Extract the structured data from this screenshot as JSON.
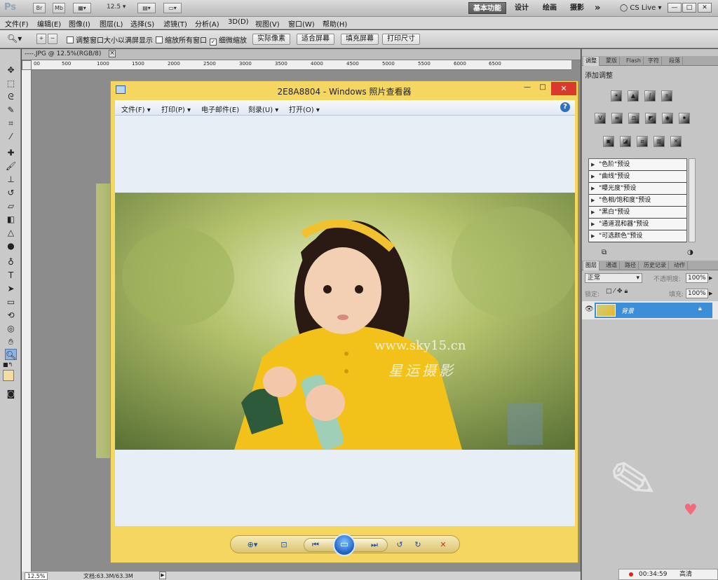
{
  "app": {
    "logo": "Ps",
    "zoom_combo": "12.5",
    "workspaces": [
      "基本功能",
      "设计",
      "绘画",
      "摄影"
    ],
    "more_glyph": "»",
    "cs_live": "CS Live",
    "win_buttons": [
      "—",
      "□",
      "✕"
    ]
  },
  "menubar": {
    "items": [
      "文件(F)",
      "编辑(E)",
      "图像(I)",
      "图层(L)",
      "选择(S)",
      "滤镜(T)",
      "分析(A)",
      "3D(D)",
      "视图(V)",
      "窗口(W)",
      "帮助(H)"
    ]
  },
  "options": {
    "chk_fit": "调整窗口大小以满屏显示",
    "chk_all": "缩放所有窗口",
    "chk_scrubby": "细微缩放",
    "btn_actual": "实际像素",
    "btn_fit": "适合屏幕",
    "btn_fill": "填充屏幕",
    "btn_print": "打印尺寸"
  },
  "doc": {
    "tab_label": "----.JPG @ 12.5%(RGB/8)",
    "tab_close": "×",
    "ruler_labels": [
      "00",
      "500",
      "1000",
      "1500",
      "2000",
      "2500",
      "3000",
      "3500",
      "4000",
      "4500",
      "5000",
      "5500",
      "6000",
      "6500"
    ],
    "status_zoom": "12.5%",
    "status_doc": "文档:63.3M/63.3M"
  },
  "viewer": {
    "title": "2E8A8804 - Windows 照片查看器",
    "menu": [
      "文件(F)",
      "打印(P)",
      "电子邮件(E)",
      "刻录(U)",
      "打开(O)"
    ],
    "help": "?",
    "watermark_url": "www.sky15.cn",
    "watermark_cn": "星运摄影",
    "controls": [
      "—",
      "□",
      "✕"
    ]
  },
  "right": {
    "top_tabs": [
      "调整",
      "蒙版",
      "Flash",
      "字符",
      "段落"
    ],
    "add_adjust": "添加调整",
    "presets": [
      "\"色阶\"预设",
      "\"曲线\"预设",
      "\"曝光度\"预设",
      "\"色相/饱和度\"预设",
      "\"黑白\"预设",
      "\"通道混和器\"预设",
      "\"可选颜色\"预设"
    ],
    "layer_tabs": [
      "图层",
      "通道",
      "路径",
      "历史记录",
      "动作"
    ],
    "blend_mode": "正常",
    "opacity_label": "不透明度:",
    "opacity_value": "100%",
    "lock_label": "锁定:",
    "fill_label": "填充:",
    "fill_value": "100%",
    "layer_name": "背景"
  },
  "recorder": {
    "time": "00:34:59",
    "quality": "高清"
  },
  "colors": {
    "viewer_frame": "#f5d660",
    "layer_selected": "#3c8ed8",
    "close_red": "#d9392b"
  }
}
